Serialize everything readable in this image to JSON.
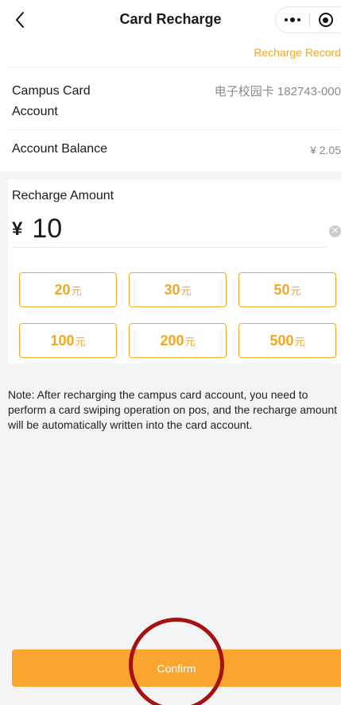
{
  "header": {
    "title": "Card Recharge",
    "back_icon": "chevron-left-icon",
    "more_icon": "more-dots-icon",
    "target_icon": "record-target-icon"
  },
  "record_link": "Recharge Record",
  "account": {
    "label": "Campus Card Account",
    "value": "电子校园卡 182743-000"
  },
  "balance": {
    "label": "Account Balance",
    "value": "¥ 2.05"
  },
  "amount": {
    "title": "Recharge Amount",
    "currency": "¥",
    "value": "10",
    "clear_icon": "clear-circle-icon"
  },
  "presets": [
    {
      "amount": "20",
      "unit": "元"
    },
    {
      "amount": "30",
      "unit": "元"
    },
    {
      "amount": "50",
      "unit": "元"
    },
    {
      "amount": "100",
      "unit": "元"
    },
    {
      "amount": "200",
      "unit": "元"
    },
    {
      "amount": "500",
      "unit": "元"
    }
  ],
  "note": "Note: After recharging the campus card account, you need to perform a card swiping operation on pos, and the recharge amount will be automatically written into the card account.",
  "confirm_label": "Confirm",
  "colors": {
    "accent": "#f5a623",
    "confirm_bg": "#f8a62f",
    "highlight_ring": "#a51212"
  }
}
